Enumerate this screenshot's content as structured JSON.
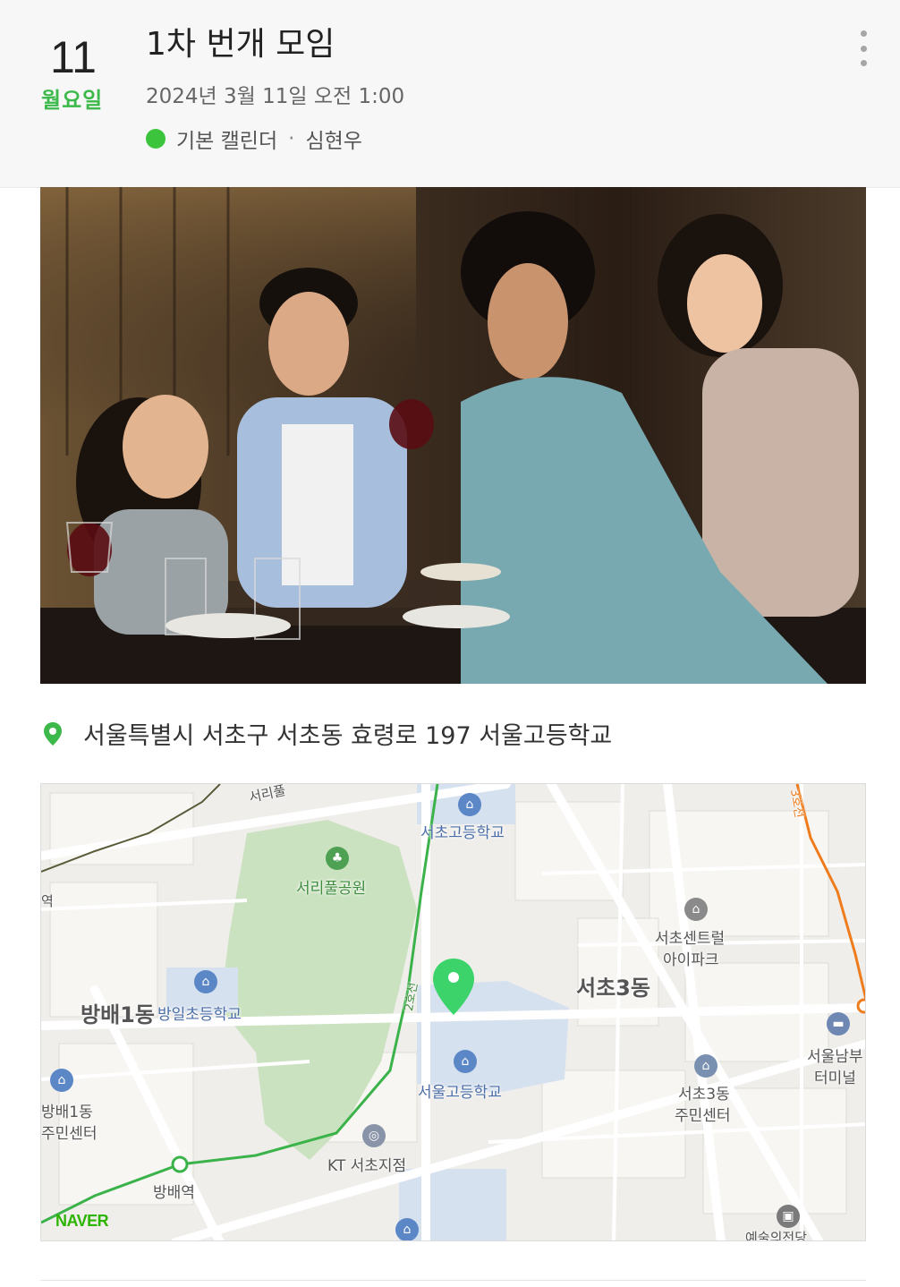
{
  "event": {
    "day": "11",
    "weekday": "월요일",
    "title": "1차 번개 모임",
    "datetime": "2024년 3월 11일 오전 1:00",
    "calendar": "기본 캘린더",
    "separator": "·",
    "owner": "심현우"
  },
  "location": {
    "address": "서울특별시 서초구 서초동 효령로 197 서울고등학교"
  },
  "map": {
    "labels": {
      "seocho_high": "서초고등학교",
      "seoripul_park": "서리풀공원",
      "seocho_center": "서초센트럴",
      "ipark": "아이파크",
      "seocho3": "서초3동",
      "bangbae1": "방배1동",
      "bangil_elem": "방일초등학교",
      "seoul_high": "서울고등학교",
      "seoul_nambu_1": "서울남부",
      "seoul_nambu_2": "터미널",
      "bangbae1_center_1": "방배1동",
      "bangbae1_center_2": "주민센터",
      "seocho3_center_1": "서초3동",
      "seocho3_center_2": "주민센터",
      "kt": "KT 서초지점",
      "bangbae_station": "방배역",
      "line2": "2호선",
      "line3": "3호선",
      "seoriro": "서리풀",
      "art_center": "예술의전당",
      "station_edge": "역"
    },
    "provider": "NAVER"
  },
  "colors": {
    "accent_green": "#3cb94a",
    "calendar_dot": "#3cc43c",
    "line2": "#3bb34a",
    "line3": "#ef7c1c"
  }
}
